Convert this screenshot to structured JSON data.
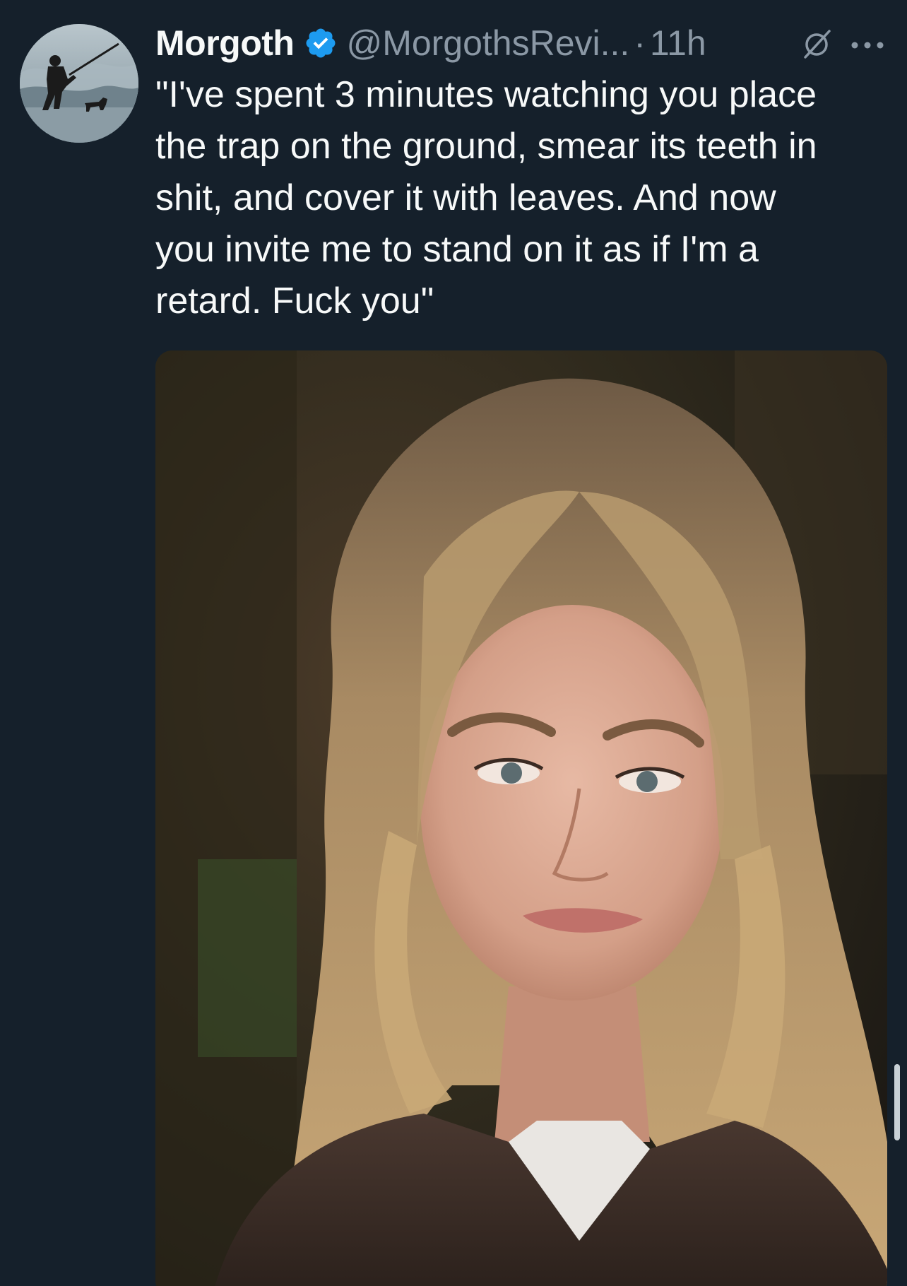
{
  "tweet": {
    "author": {
      "display_name": "Morgoth",
      "handle": "@MorgothsRevi...",
      "verified": true,
      "avatar_icon": "fisherman-with-dog-avatar"
    },
    "separator": "·",
    "timestamp": "11h",
    "text_lines": [
      "\"I've spent 3 minutes watching you place",
      "the trap on the ground, smear its teeth in",
      "shit, and cover it with leaves. And now",
      "you invite me to stand on it as if I'm a",
      "retard. Fuck you\""
    ],
    "media": {
      "type": "photo",
      "icon": "photo-of-woman-with-long-blonde-hair"
    }
  },
  "icons": {
    "verified": "verified-badge-icon",
    "mute": "mute-icon",
    "more": "more-options-icon"
  },
  "colors": {
    "background": "#15202b",
    "text_primary": "#f7f9f9",
    "text_secondary": "#8b98a5",
    "verified_blue": "#1d9bf0"
  }
}
